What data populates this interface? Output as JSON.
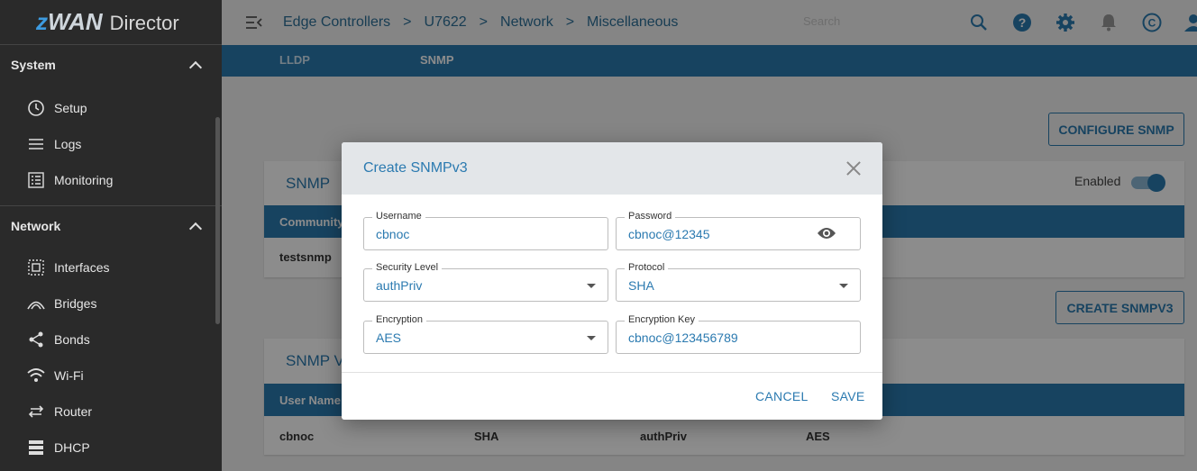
{
  "app": {
    "brand_z": "z",
    "brand_wan": "WAN",
    "brand_suffix": "Director"
  },
  "sidebar": {
    "sections": [
      {
        "title": "System",
        "items": [
          {
            "label": "Setup",
            "icon": "clock-icon"
          },
          {
            "label": "Logs",
            "icon": "list-icon"
          },
          {
            "label": "Monitoring",
            "icon": "monitoring-icon"
          }
        ]
      },
      {
        "title": "Network",
        "items": [
          {
            "label": "Interfaces",
            "icon": "interfaces-icon"
          },
          {
            "label": "Bridges",
            "icon": "bridge-icon"
          },
          {
            "label": "Bonds",
            "icon": "share-icon"
          },
          {
            "label": "Wi-Fi",
            "icon": "wifi-icon"
          },
          {
            "label": "Router",
            "icon": "swap-icon"
          },
          {
            "label": "DHCP",
            "icon": "server-icon"
          }
        ]
      }
    ]
  },
  "breadcrumb": [
    "Edge Controllers",
    "U7622",
    "Network",
    "Miscellaneous"
  ],
  "search": {
    "placeholder": "Search"
  },
  "tabs": [
    "LLDP",
    "SNMP"
  ],
  "page": {
    "configure_button": "CONFIGURE SNMP",
    "create_button": "CREATE SNMPV3",
    "snmp_card": {
      "title": "SNMP",
      "enabled_label": "Enabled",
      "enabled": true,
      "column": "Community",
      "row_value": "testsnmp"
    },
    "snmpv3_card": {
      "title": "SNMP V",
      "column": "User Name",
      "row": [
        "cbnoc",
        "SHA",
        "authPriv",
        "AES"
      ]
    }
  },
  "dialog": {
    "title": "Create SNMPv3",
    "fields": {
      "username": {
        "label": "Username",
        "value": "cbnoc"
      },
      "password": {
        "label": "Password",
        "value": "cbnoc@12345"
      },
      "security_level": {
        "label": "Security Level",
        "value": "authPriv"
      },
      "protocol": {
        "label": "Protocol",
        "value": "SHA"
      },
      "encryption": {
        "label": "Encryption",
        "value": "AES"
      },
      "encryption_key": {
        "label": "Encryption Key",
        "value": "cbnoc@123456789"
      }
    },
    "cancel_label": "CANCEL",
    "save_label": "SAVE"
  },
  "colors": {
    "accent": "#2b7ab0",
    "sidebar_bg": "#2a2a2a"
  }
}
